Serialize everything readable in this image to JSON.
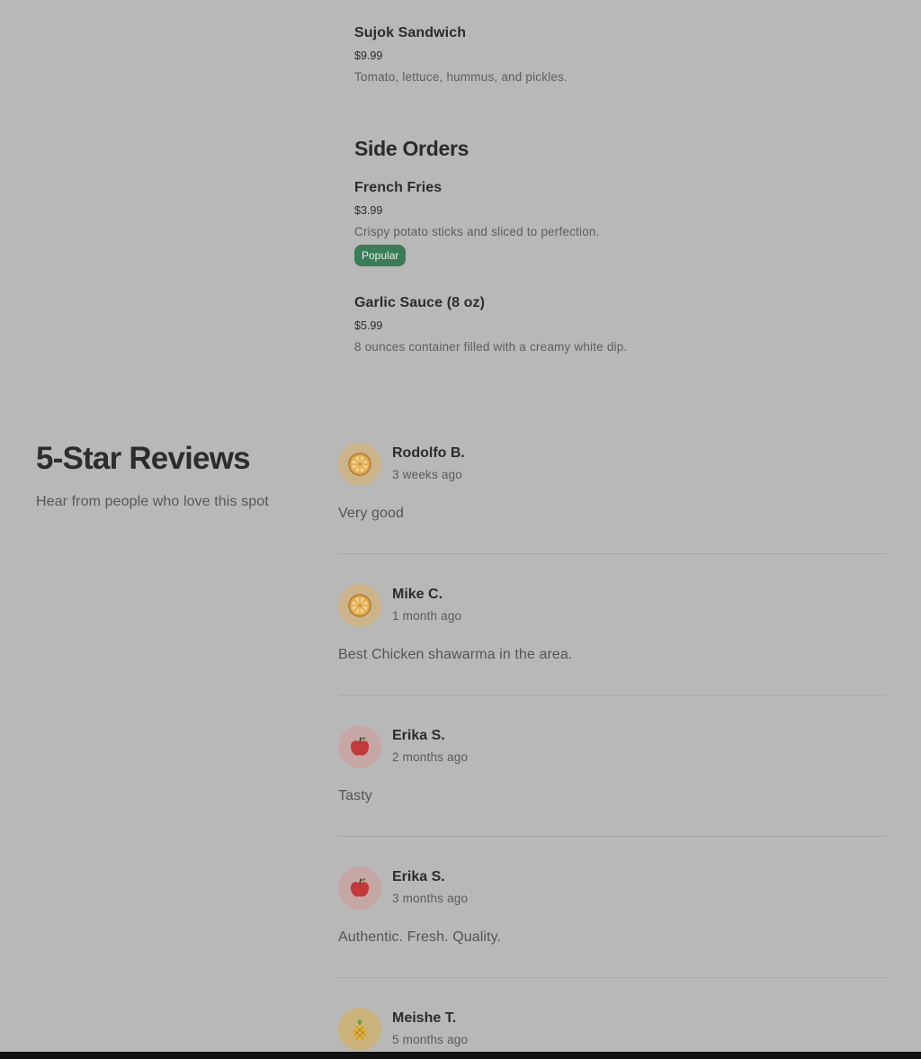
{
  "menu": {
    "items_top": [
      {
        "name": "Sujok Sandwich",
        "price": "$9.99",
        "description": "Tomato, lettuce, hummus, and pickles."
      }
    ],
    "side_orders": {
      "title": "Side Orders",
      "items": [
        {
          "name": "French Fries",
          "price": "$3.99",
          "description": "Crispy potato sticks and sliced to perfection.",
          "badge": "Popular"
        },
        {
          "name": "Garlic Sauce (8 oz)",
          "price": "$5.99",
          "description": "8 ounces container filled with a creamy white dip."
        }
      ]
    }
  },
  "reviews": {
    "title": "5-Star Reviews",
    "subtitle": "Hear from people who love this spot",
    "items": [
      {
        "name": "Rodolfo B.",
        "date": "3 weeks ago",
        "text": "Very good",
        "avatar_icon": "orange-slice-icon"
      },
      {
        "name": "Mike C.",
        "date": "1 month ago",
        "text": "Best Chicken shawarma in the area.",
        "avatar_icon": "orange-slice-icon"
      },
      {
        "name": "Erika S.",
        "date": "2 months ago",
        "text": "Tasty",
        "avatar_icon": "apple-icon"
      },
      {
        "name": "Erika S.",
        "date": "3 months ago",
        "text": "Authentic. Fresh. Quality.",
        "avatar_icon": "apple-icon"
      },
      {
        "name": "Meishe T.",
        "date": "5 months ago",
        "text": "",
        "avatar_icon": "pineapple-icon"
      }
    ]
  },
  "colors": {
    "background": "#b8b8b8",
    "badge": "#3a7b58",
    "avatar_orange_bg": "#cbb48a",
    "avatar_apple_bg": "#c7a6a6",
    "avatar_pineapple_bg": "#c9b37a"
  }
}
